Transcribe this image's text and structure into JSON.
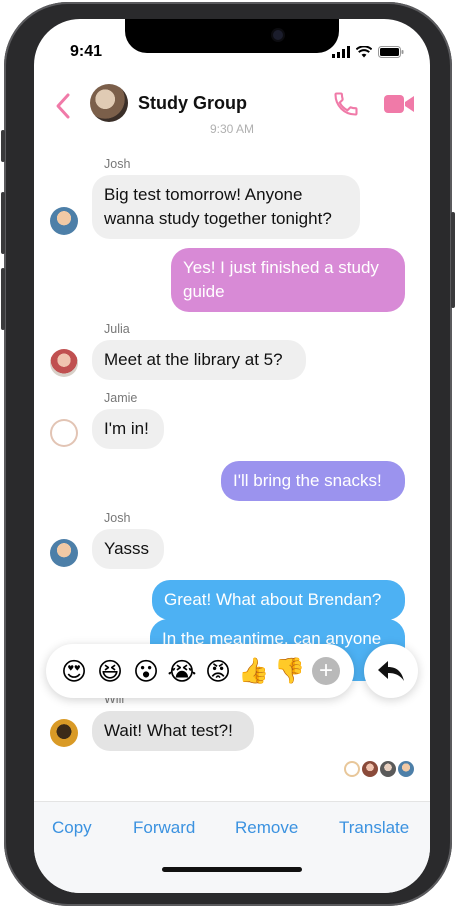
{
  "status_bar": {
    "time": "9:41"
  },
  "header": {
    "title": "Study Group",
    "back_icon": "chevron-left-icon",
    "call_icon": "phone-icon",
    "video_icon": "video-camera-icon",
    "accent_color": "#f07aa8"
  },
  "timestamp": "9:30 AM",
  "messages": [
    {
      "sender": "Josh",
      "text_lines": [
        "Big test tomorrow! Anyone",
        "wanna study together tonight?"
      ],
      "direction": "in"
    },
    {
      "sender": "",
      "text_lines": [
        "Yes! I just finished a study",
        "guide"
      ],
      "direction": "out",
      "color": "#d88ad6"
    },
    {
      "sender": "Julia",
      "text_lines": [
        "Meet at the library at 5?"
      ],
      "direction": "in"
    },
    {
      "sender": "Jamie",
      "text_lines": [
        "I'm in!"
      ],
      "direction": "in"
    },
    {
      "sender": "",
      "text_lines": [
        "I'll bring the snacks!"
      ],
      "direction": "out",
      "color": "#9b93ee"
    },
    {
      "sender": "Josh",
      "text_lines": [
        "Yasss"
      ],
      "direction": "in"
    },
    {
      "sender": "",
      "text_lines": [
        "Great! What about Brendan?"
      ],
      "direction": "out",
      "color": "#4db1f3"
    },
    {
      "sender": "",
      "text_lines": [
        "In the meantime, can anyone"
      ],
      "direction": "out",
      "color": "#4db1f3"
    },
    {
      "sender": "Will",
      "text_lines": [
        "Wait! What test?!"
      ],
      "direction": "in"
    }
  ],
  "reactions": [
    "😍",
    "😆",
    "😮",
    "😭",
    "😡",
    "👍",
    "👎"
  ],
  "reaction_add_label": "+",
  "reply_icon": "reply-arrow-icon",
  "actions": {
    "copy": "Copy",
    "forward": "Forward",
    "remove": "Remove",
    "translate": "Translate"
  }
}
